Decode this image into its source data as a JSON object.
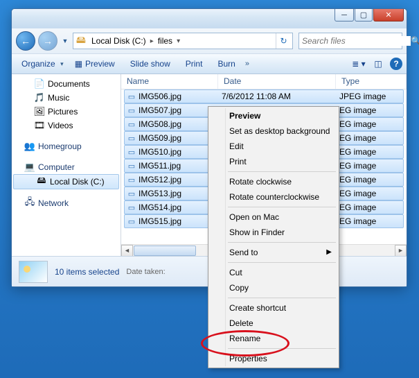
{
  "titlebar": {},
  "nav": {
    "crumb1": "Local Disk (C:)",
    "crumb2": "files",
    "search_placeholder": "Search files"
  },
  "toolbar": {
    "organize": "Organize",
    "preview": "Preview",
    "slideshow": "Slide show",
    "print": "Print",
    "burn": "Burn"
  },
  "sidebar": {
    "documents": "Documents",
    "music": "Music",
    "pictures": "Pictures",
    "videos": "Videos",
    "homegroup": "Homegroup",
    "computer": "Computer",
    "localdisk": "Local Disk (C:)",
    "network": "Network"
  },
  "columns": {
    "name": "Name",
    "date": "Date",
    "type": "Type"
  },
  "files": [
    {
      "name": "IMG506.jpg",
      "date": "7/6/2012 11:08 AM",
      "type": "JPEG image"
    },
    {
      "name": "IMG507.jpg",
      "date": "",
      "type": "EG image"
    },
    {
      "name": "IMG508.jpg",
      "date": "",
      "type": "EG image"
    },
    {
      "name": "IMG509.jpg",
      "date": "",
      "type": "EG image"
    },
    {
      "name": "IMG510.jpg",
      "date": "",
      "type": "EG image"
    },
    {
      "name": "IMG511.jpg",
      "date": "",
      "type": "EG image"
    },
    {
      "name": "IMG512.jpg",
      "date": "",
      "type": "EG image"
    },
    {
      "name": "IMG513.jpg",
      "date": "",
      "type": "EG image"
    },
    {
      "name": "IMG514.jpg",
      "date": "",
      "type": "EG image"
    },
    {
      "name": "IMG515.jpg",
      "date": "",
      "type": "EG image"
    }
  ],
  "details": {
    "selection": "10 items selected",
    "meta": "Date taken:"
  },
  "context": {
    "preview": "Preview",
    "setbg": "Set as desktop background",
    "edit": "Edit",
    "print": "Print",
    "rotcw": "Rotate clockwise",
    "rotccw": "Rotate counterclockwise",
    "openmac": "Open on Mac",
    "showfinder": "Show in Finder",
    "sendto": "Send to",
    "cut": "Cut",
    "copy": "Copy",
    "shortcut": "Create shortcut",
    "delete": "Delete",
    "rename": "Rename",
    "properties": "Properties"
  }
}
